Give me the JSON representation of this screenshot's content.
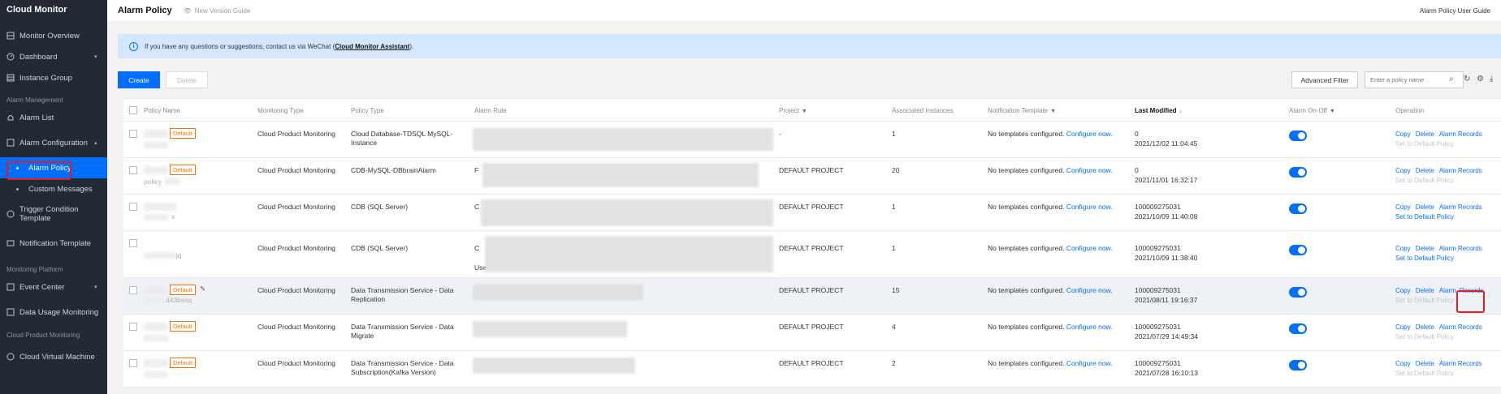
{
  "sidebar": {
    "brand": "Cloud Monitor",
    "items": [
      {
        "label": "Monitor Overview",
        "icon": "monitor-icon"
      },
      {
        "label": "Dashboard",
        "icon": "dashboard-icon"
      },
      {
        "label": "Instance Group",
        "icon": "grid-icon"
      }
    ],
    "section_alarm": "Alarm Management",
    "alarm_list": "Alarm List",
    "alarm_config": "Alarm Configuration",
    "alarm_policy": "Alarm Policy",
    "custom_messages": "Custom Messages",
    "trigger_condition": "Trigger Condition Template",
    "notification_template": "Notification Template",
    "section_platform": "Monitoring Platform",
    "event_center": "Event Center",
    "data_usage": "Data Usage Monitoring",
    "section_cloud": "Cloud Product Monitoring",
    "cloud_vm": "Cloud Virtual Machine"
  },
  "header": {
    "title": "Alarm Policy",
    "new_version_guide": "New Version Guide",
    "user_guide": "Alarm Policy User Guide"
  },
  "banner": {
    "text_prefix": "If you have any questions or suggestions, contact us via WeChat (",
    "assistant": "Cloud Monitor Assistant",
    "text_suffix": ")."
  },
  "toolbar": {
    "create": "Create",
    "delete": "Delete",
    "advanced_filter": "Advanced Filter",
    "search_placeholder": "Enter a policy name"
  },
  "table": {
    "headers": {
      "policy_name": "Policy Name",
      "monitoring_type": "Monitoring Type",
      "policy_type": "Policy Type",
      "alarm_rule": "Alarm Rule",
      "project": "Project",
      "associated_instances": "Associated Instances",
      "notification_template": "Notification Template",
      "last_modified": "Last Modified",
      "alarm_onoff": "Alarm On-Off",
      "operation": "Operation"
    },
    "default_tag": "Default",
    "no_template": "No templates configured.",
    "configure_now": "Configure now.",
    "op_copy": "Copy",
    "op_delete": "Delete",
    "op_alarm_records": "Alarm Records",
    "op_alarm": "Alarm",
    "op_records": "Records",
    "op_set_default": "Set to Default Policy",
    "rows": [
      {
        "name_frag": "",
        "monitoring_type": "Cloud Product Monitoring",
        "policy_type": "Cloud Database-TDSQL MySQL-Instance",
        "rule_frag": "",
        "project": "-",
        "instances": "1",
        "modifier": "0",
        "modified": "2021/12/02 11:04:45"
      },
      {
        "name_frag": "policy",
        "monitoring_type": "Cloud Product Monitoring",
        "policy_type": "CDB-MySQL-DBbrainAlarm",
        "rule_frag": "F",
        "project": "DEFAULT PROJECT",
        "instances": "20",
        "modifier": "0",
        "modified": "2021/11/01 16:32:17"
      },
      {
        "name_frag": "x",
        "monitoring_type": "Cloud Product Monitoring",
        "policy_type": "CDB (SQL Server)",
        "rule_frag": "C",
        "project": "DEFAULT PROJECT",
        "instances": "1",
        "modifier": "100009275031",
        "modified": "2021/10/09 11:40:08"
      },
      {
        "name_frag": "jq",
        "monitoring_type": "Cloud Product Monitoring",
        "policy_type": "CDB (SQL Server)",
        "rule_frag": "Use",
        "project": "DEFAULT PROJECT",
        "instances": "1",
        "modifier": "100009275031",
        "modified": "2021/10/09 11:38:40"
      },
      {
        "name_frag": "d43bssq",
        "monitoring_type": "Cloud Product Monitoring",
        "policy_type": "Data Transmission Service - Data Replication",
        "rule_frag": "",
        "project": "DEFAULT PROJECT",
        "instances": "15",
        "modifier": "100009275031",
        "modified": "2021/08/11 19:16:37"
      },
      {
        "name_frag": "",
        "monitoring_type": "Cloud Product Monitoring",
        "policy_type": "Data Transmission Service - Data Migrate",
        "rule_frag": "",
        "project": "DEFAULT PROJECT",
        "instances": "4",
        "modifier": "100009275031",
        "modified": "2021/07/29 14:49:34"
      },
      {
        "name_frag": "",
        "monitoring_type": "Cloud Product Monitoring",
        "policy_type": "Data Transmission Service - Data Subscription(Kafka Version)",
        "rule_frag": "",
        "project": "DEFAULT PROJECT",
        "instances": "2",
        "modifier": "100009275031",
        "modified": "2021/07/28 16:10:13"
      }
    ]
  },
  "colors": {
    "accent": "#006eff",
    "sidebar_bg": "#232a36",
    "tag": "#ff7200",
    "highlight": "#e02020"
  }
}
